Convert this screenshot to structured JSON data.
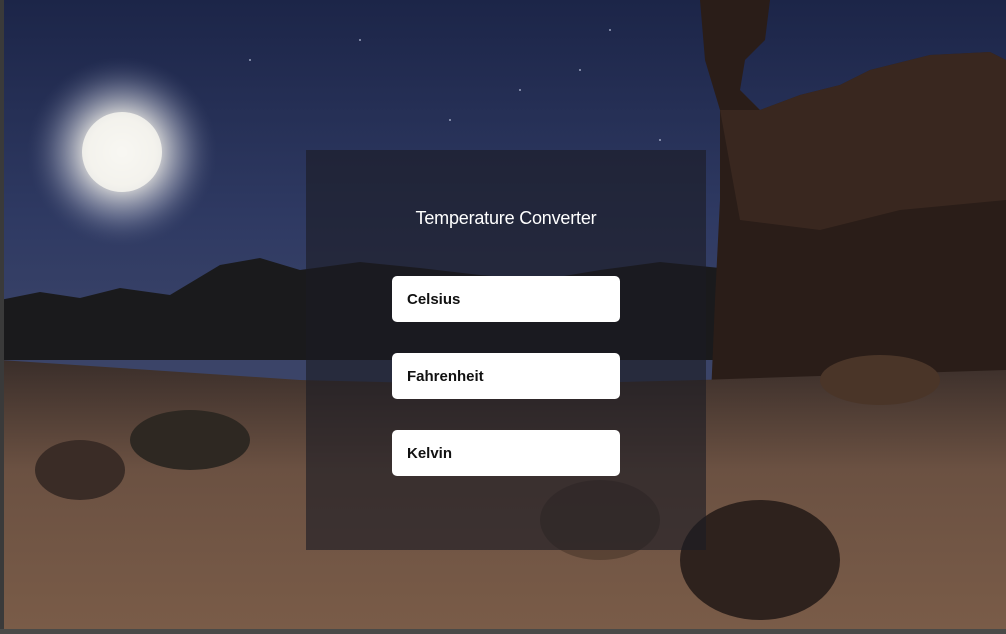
{
  "app": {
    "title": "Temperature Converter"
  },
  "inputs": {
    "celsius": {
      "placeholder": "Celsius",
      "value": ""
    },
    "fahrenheit": {
      "placeholder": "Fahrenheit",
      "value": ""
    },
    "kelvin": {
      "placeholder": "Kelvin",
      "value": ""
    }
  },
  "background": {
    "scene": "night-desert-moon",
    "sky_color": "#2f3a63",
    "ground_color": "#6b5142"
  },
  "colors": {
    "panel": "#1c1c24",
    "input_background": "#ffffff",
    "input_text": "#111111",
    "title_text": "#ffffff"
  }
}
